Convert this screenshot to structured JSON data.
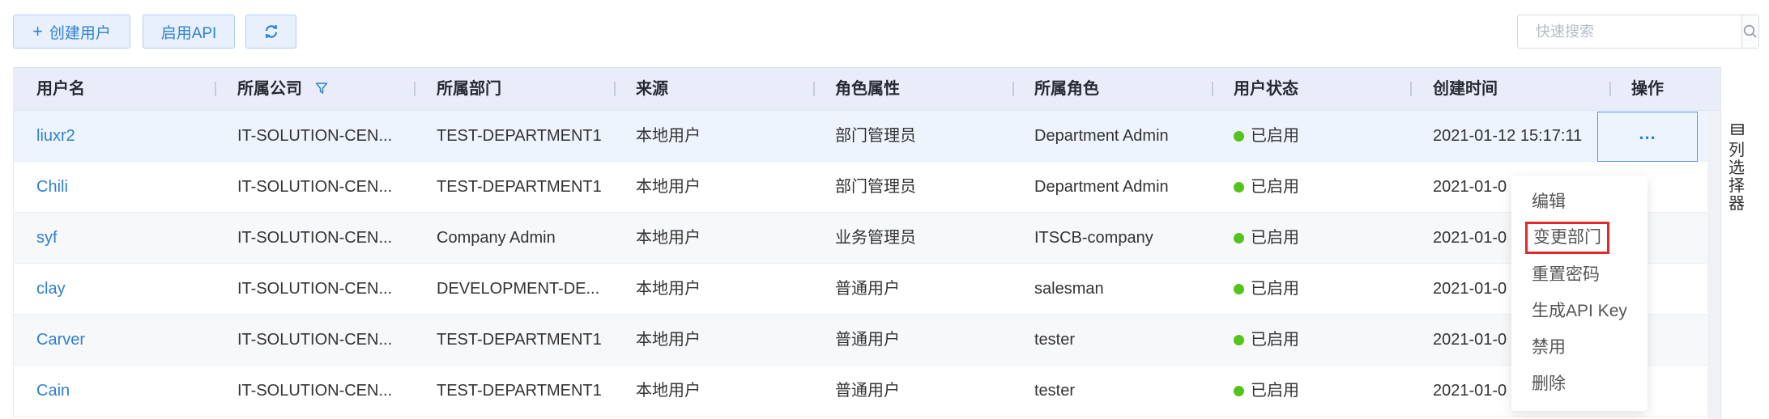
{
  "toolbar": {
    "create_label": "创建用户",
    "api_label": "启用API",
    "search_placeholder": "快速搜索"
  },
  "columns": [
    "用户名",
    "所属公司",
    "所属部门",
    "来源",
    "角色属性",
    "所属角色",
    "用户状态",
    "创建时间",
    "操作"
  ],
  "rows": [
    {
      "user": "liuxr2",
      "company": "IT-SOLUTION-CEN...",
      "dept": "TEST-DEPARTMENT1",
      "source": "本地用户",
      "role_attr": "部门管理员",
      "role": "Department Admin",
      "status": "已启用",
      "created": "2021-01-12 15:17:11"
    },
    {
      "user": "Chili",
      "company": "IT-SOLUTION-CEN...",
      "dept": "TEST-DEPARTMENT1",
      "source": "本地用户",
      "role_attr": "部门管理员",
      "role": "Department Admin",
      "status": "已启用",
      "created": "2021-01-0"
    },
    {
      "user": "syf",
      "company": "IT-SOLUTION-CEN...",
      "dept": "Company Admin",
      "source": "本地用户",
      "role_attr": "业务管理员",
      "role": "ITSCB-company",
      "status": "已启用",
      "created": "2021-01-0"
    },
    {
      "user": "clay",
      "company": "IT-SOLUTION-CEN...",
      "dept": "DEVELOPMENT-DE...",
      "source": "本地用户",
      "role_attr": "普通用户",
      "role": "salesman",
      "status": "已启用",
      "created": "2021-01-0"
    },
    {
      "user": "Carver",
      "company": "IT-SOLUTION-CEN...",
      "dept": "TEST-DEPARTMENT1",
      "source": "本地用户",
      "role_attr": "普通用户",
      "role": "tester",
      "status": "已启用",
      "created": "2021-01-0"
    },
    {
      "user": "Cain",
      "company": "IT-SOLUTION-CEN...",
      "dept": "TEST-DEPARTMENT1",
      "source": "本地用户",
      "role_attr": "普通用户",
      "role": "tester",
      "status": "已启用",
      "created": "2021-01-0"
    }
  ],
  "menu": [
    "编辑",
    "变更部门",
    "重置密码",
    "生成API Key",
    "禁用",
    "删除"
  ],
  "column_chooser_label": "列选择器",
  "colors": {
    "accent": "#2f7fd0",
    "status_enabled": "#52c41a",
    "highlight": "#e0282e"
  }
}
